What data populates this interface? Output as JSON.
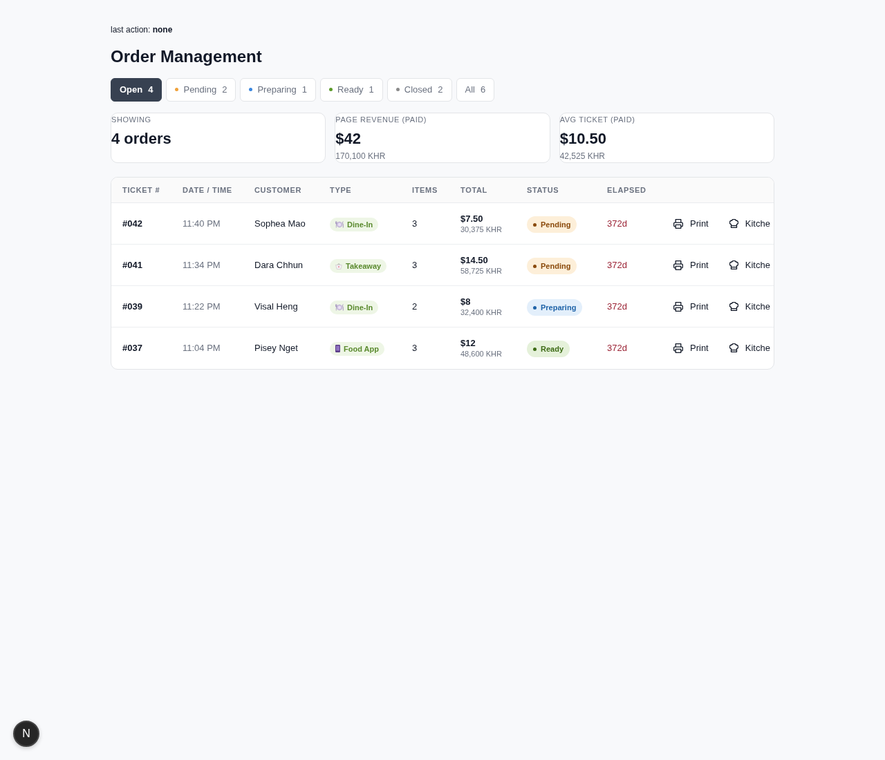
{
  "last_action": "last action: **none**",
  "title": "Order Management",
  "filters": [
    {
      "label": "Open",
      "count": "4",
      "selected": true
    },
    {
      "label": "Pending",
      "count": "2",
      "selected": false,
      "color": "#f0a23b"
    },
    {
      "label": "Preparing",
      "count": "1",
      "selected": false,
      "color": "#3b87e0"
    },
    {
      "label": "Ready",
      "count": "1",
      "selected": false,
      "color": "#5b9a2a"
    },
    {
      "label": "Closed",
      "count": "2",
      "selected": false,
      "color": "#8a8a8a"
    },
    {
      "label": "All",
      "count": "6",
      "selected": false
    }
  ],
  "stats": [
    {
      "label": "SHOWING",
      "value": "4 orders"
    },
    {
      "label": "PAGE REVENUE (PAID)",
      "value": "$42",
      "sub": "170,100 KHR"
    },
    {
      "label": "AVG TICKET (PAID)",
      "value": "$10.50",
      "sub": "42,525 KHR"
    }
  ],
  "table": {
    "columns": [
      "TICKET #",
      "DATE / TIME",
      "CUSTOMER",
      "TYPE",
      "ITEMS",
      "TOTAL",
      "STATUS",
      "ELAPSED"
    ],
    "rows": [
      {
        "ticket": "#042",
        "time": "11:40 PM",
        "customer": "Sophea Mao",
        "type": {
          "kind": "dine-in",
          "label": "Dine-In"
        },
        "items": "3",
        "total": "$7.50",
        "total_khr": "30,375 KHR",
        "status": {
          "kind": "pending",
          "label": "Pending"
        },
        "elapsed": "372d",
        "actions": [
          {
            "kind": "print",
            "label": "Print"
          },
          {
            "kind": "kitchen",
            "label": "Kitche"
          }
        ]
      },
      {
        "ticket": "#041",
        "time": "11:34 PM",
        "customer": "Dara Chhun",
        "type": {
          "kind": "takeaway",
          "label": "Takeaway"
        },
        "items": "3",
        "total": "$14.50",
        "total_khr": "58,725 KHR",
        "status": {
          "kind": "pending",
          "label": "Pending"
        },
        "elapsed": "372d",
        "actions": [
          {
            "kind": "print",
            "label": "Print"
          },
          {
            "kind": "kitchen",
            "label": "Kitche"
          }
        ]
      },
      {
        "ticket": "#039",
        "time": "11:22 PM",
        "customer": "Visal Heng",
        "type": {
          "kind": "dine-in",
          "label": "Dine-In"
        },
        "items": "2",
        "total": "$8",
        "total_khr": "32,400 KHR",
        "status": {
          "kind": "preparing",
          "label": "Preparing"
        },
        "elapsed": "372d",
        "actions": [
          {
            "kind": "print",
            "label": "Print"
          },
          {
            "kind": "kitchen",
            "label": "Kitche"
          }
        ]
      },
      {
        "ticket": "#037",
        "time": "11:04 PM",
        "customer": "Pisey Nget",
        "type": {
          "kind": "food-app",
          "label": "Food App"
        },
        "items": "3",
        "total": "$12",
        "total_khr": "48,600 KHR",
        "status": {
          "kind": "ready",
          "label": "Ready"
        },
        "elapsed": "372d",
        "actions": [
          {
            "kind": "print",
            "label": "Print"
          },
          {
            "kind": "kitchen",
            "label": "Kitche"
          }
        ]
      }
    ]
  },
  "dev_badge": "N"
}
